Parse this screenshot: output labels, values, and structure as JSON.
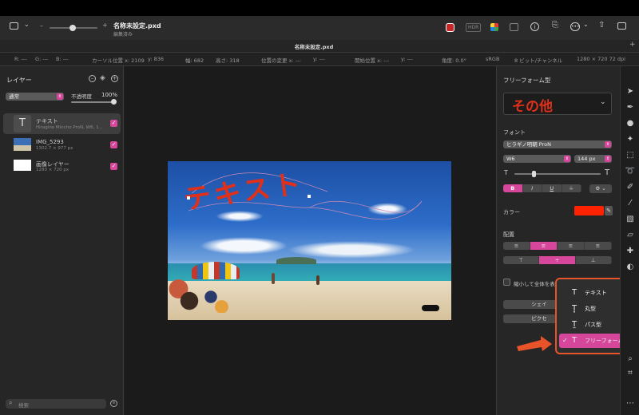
{
  "window": {
    "title": "名称未設定.pxd",
    "subtitle": "編集済み",
    "tab_title": "名称未設定.pxd",
    "hdr_label": "HDR"
  },
  "infobar": {
    "r": "R: ---",
    "g": "G: ---",
    "b": "B: ---",
    "cursor_x": "カーソル位置 x: 2109",
    "cursor_y": "y: 836",
    "width": "幅: 682",
    "height": "高さ: 318",
    "move_x": "位置の変更 x: ---",
    "move_y": "y: ---",
    "start_x": "開始位置 x: ---",
    "start_y": "y: ---",
    "angle": "角度: 0.0°",
    "colorspace": "sRGB",
    "depth": "8 ビット/チャンネル",
    "size": "1280 × 720 72 dpi"
  },
  "layers": {
    "header": "レイヤー",
    "blend_mode": "通常",
    "opacity_label": "不透明度",
    "opacity_value": "100%",
    "items": [
      {
        "name": "テキスト",
        "detail": "Hiragino Mincho ProN, W6, 1..."
      },
      {
        "name": "IMG_5293",
        "detail": "1302.7 × 977 px"
      },
      {
        "name": "画像レイヤー",
        "detail": "1280 × 720 px"
      }
    ],
    "search_placeholder": "検索"
  },
  "canvas": {
    "text": "テキスト"
  },
  "inspector": {
    "title": "フリーフォーム型",
    "style_preview": "その他",
    "font_section": "フォント",
    "font_family": "ヒラギノ明朝 ProN",
    "font_weight": "W6",
    "font_size": "144 px",
    "style_buttons": [
      "B",
      "I",
      "U",
      "S"
    ],
    "gear_label": "⚙",
    "color_label": "カラー",
    "color_value": "#ff2200",
    "align_section": "配置",
    "shrink_label": "縮小して全体を表",
    "shape_button": "シェイ",
    "pixel_button": "ピクセ"
  },
  "dropdown": {
    "items": [
      {
        "label": "テキスト",
        "selected": false
      },
      {
        "label": "丸型",
        "selected": false
      },
      {
        "label": "パス型",
        "selected": false
      },
      {
        "label": "フリーフォーム型",
        "selected": true
      }
    ],
    "accent": "#d6479b",
    "outline": "#e8532a"
  }
}
